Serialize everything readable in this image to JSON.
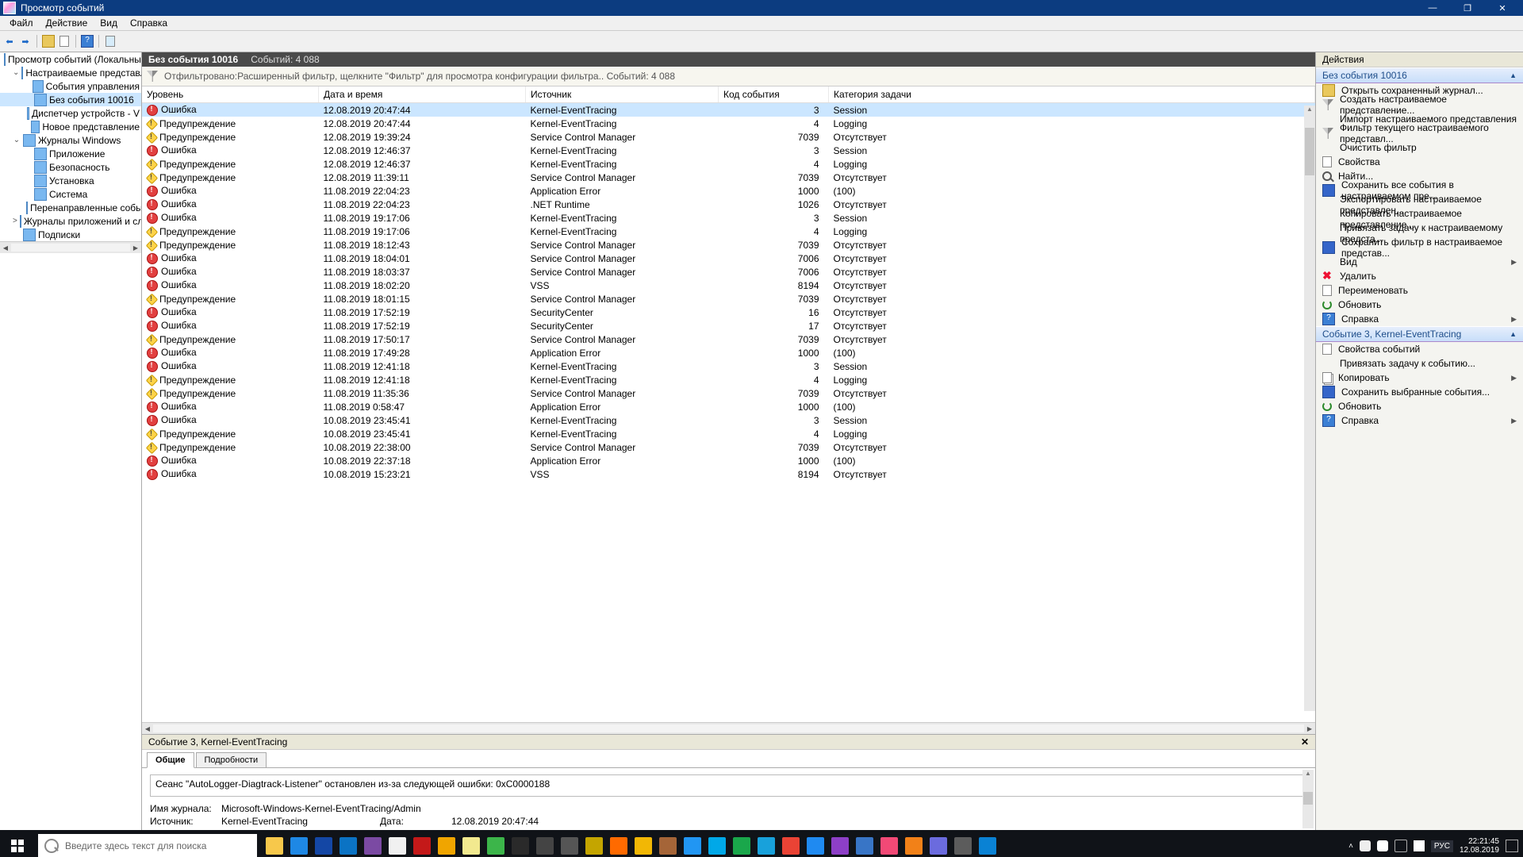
{
  "window": {
    "title": "Просмотр событий",
    "min": "—",
    "max": "❐",
    "close": "✕"
  },
  "menubar": [
    "Файл",
    "Действие",
    "Вид",
    "Справка"
  ],
  "center_header": {
    "title": "Без события 10016",
    "count": "Событий: 4 088"
  },
  "filter_text": "Отфильтровано:Расширенный фильтр, щелкните \"Фильтр\" для просмотра конфигурации фильтра.. Событий: 4 088",
  "tree": [
    {
      "indent": 0,
      "toggle": "",
      "label": "Просмотр событий (Локальный"
    },
    {
      "indent": 1,
      "toggle": "⌄",
      "label": "Настраиваемые представле"
    },
    {
      "indent": 2,
      "toggle": "",
      "label": "События управления"
    },
    {
      "indent": 2,
      "toggle": "",
      "label": "Без события 10016",
      "selected": true
    },
    {
      "indent": 2,
      "toggle": "",
      "label": "Диспетчер устройств - V"
    },
    {
      "indent": 2,
      "toggle": "",
      "label": "Новое представление"
    },
    {
      "indent": 1,
      "toggle": "⌄",
      "label": "Журналы Windows"
    },
    {
      "indent": 2,
      "toggle": "",
      "label": "Приложение"
    },
    {
      "indent": 2,
      "toggle": "",
      "label": "Безопасность"
    },
    {
      "indent": 2,
      "toggle": "",
      "label": "Установка"
    },
    {
      "indent": 2,
      "toggle": "",
      "label": "Система"
    },
    {
      "indent": 2,
      "toggle": "",
      "label": "Перенаправленные собы"
    },
    {
      "indent": 1,
      "toggle": ">",
      "label": "Журналы приложений и слу"
    },
    {
      "indent": 1,
      "toggle": "",
      "label": "Подписки"
    }
  ],
  "columns": {
    "level": "Уровень",
    "datetime": "Дата и время",
    "source": "Источник",
    "code": "Код события",
    "category": "Категория задачи"
  },
  "events": [
    {
      "lv": "e",
      "level": "Ошибка",
      "dt": "12.08.2019 20:47:44",
      "src": "Kernel-EventTracing",
      "code": "3",
      "cat": "Session",
      "sel": true
    },
    {
      "lv": "w",
      "level": "Предупреждение",
      "dt": "12.08.2019 20:47:44",
      "src": "Kernel-EventTracing",
      "code": "4",
      "cat": "Logging"
    },
    {
      "lv": "w",
      "level": "Предупреждение",
      "dt": "12.08.2019 19:39:24",
      "src": "Service Control Manager",
      "code": "7039",
      "cat": "Отсутствует"
    },
    {
      "lv": "e",
      "level": "Ошибка",
      "dt": "12.08.2019 12:46:37",
      "src": "Kernel-EventTracing",
      "code": "3",
      "cat": "Session"
    },
    {
      "lv": "w",
      "level": "Предупреждение",
      "dt": "12.08.2019 12:46:37",
      "src": "Kernel-EventTracing",
      "code": "4",
      "cat": "Logging"
    },
    {
      "lv": "w",
      "level": "Предупреждение",
      "dt": "12.08.2019 11:39:11",
      "src": "Service Control Manager",
      "code": "7039",
      "cat": "Отсутствует"
    },
    {
      "lv": "e",
      "level": "Ошибка",
      "dt": "11.08.2019 22:04:23",
      "src": "Application Error",
      "code": "1000",
      "cat": "(100)"
    },
    {
      "lv": "e",
      "level": "Ошибка",
      "dt": "11.08.2019 22:04:23",
      "src": ".NET Runtime",
      "code": "1026",
      "cat": "Отсутствует"
    },
    {
      "lv": "e",
      "level": "Ошибка",
      "dt": "11.08.2019 19:17:06",
      "src": "Kernel-EventTracing",
      "code": "3",
      "cat": "Session"
    },
    {
      "lv": "w",
      "level": "Предупреждение",
      "dt": "11.08.2019 19:17:06",
      "src": "Kernel-EventTracing",
      "code": "4",
      "cat": "Logging"
    },
    {
      "lv": "w",
      "level": "Предупреждение",
      "dt": "11.08.2019 18:12:43",
      "src": "Service Control Manager",
      "code": "7039",
      "cat": "Отсутствует"
    },
    {
      "lv": "e",
      "level": "Ошибка",
      "dt": "11.08.2019 18:04:01",
      "src": "Service Control Manager",
      "code": "7006",
      "cat": "Отсутствует"
    },
    {
      "lv": "e",
      "level": "Ошибка",
      "dt": "11.08.2019 18:03:37",
      "src": "Service Control Manager",
      "code": "7006",
      "cat": "Отсутствует"
    },
    {
      "lv": "e",
      "level": "Ошибка",
      "dt": "11.08.2019 18:02:20",
      "src": "VSS",
      "code": "8194",
      "cat": "Отсутствует"
    },
    {
      "lv": "w",
      "level": "Предупреждение",
      "dt": "11.08.2019 18:01:15",
      "src": "Service Control Manager",
      "code": "7039",
      "cat": "Отсутствует"
    },
    {
      "lv": "e",
      "level": "Ошибка",
      "dt": "11.08.2019 17:52:19",
      "src": "SecurityCenter",
      "code": "16",
      "cat": "Отсутствует"
    },
    {
      "lv": "e",
      "level": "Ошибка",
      "dt": "11.08.2019 17:52:19",
      "src": "SecurityCenter",
      "code": "17",
      "cat": "Отсутствует"
    },
    {
      "lv": "w",
      "level": "Предупреждение",
      "dt": "11.08.2019 17:50:17",
      "src": "Service Control Manager",
      "code": "7039",
      "cat": "Отсутствует"
    },
    {
      "lv": "e",
      "level": "Ошибка",
      "dt": "11.08.2019 17:49:28",
      "src": "Application Error",
      "code": "1000",
      "cat": "(100)"
    },
    {
      "lv": "e",
      "level": "Ошибка",
      "dt": "11.08.2019 12:41:18",
      "src": "Kernel-EventTracing",
      "code": "3",
      "cat": "Session"
    },
    {
      "lv": "w",
      "level": "Предупреждение",
      "dt": "11.08.2019 12:41:18",
      "src": "Kernel-EventTracing",
      "code": "4",
      "cat": "Logging"
    },
    {
      "lv": "w",
      "level": "Предупреждение",
      "dt": "11.08.2019 11:35:36",
      "src": "Service Control Manager",
      "code": "7039",
      "cat": "Отсутствует"
    },
    {
      "lv": "e",
      "level": "Ошибка",
      "dt": "11.08.2019 0:58:47",
      "src": "Application Error",
      "code": "1000",
      "cat": "(100)"
    },
    {
      "lv": "e",
      "level": "Ошибка",
      "dt": "10.08.2019 23:45:41",
      "src": "Kernel-EventTracing",
      "code": "3",
      "cat": "Session"
    },
    {
      "lv": "w",
      "level": "Предупреждение",
      "dt": "10.08.2019 23:45:41",
      "src": "Kernel-EventTracing",
      "code": "4",
      "cat": "Logging"
    },
    {
      "lv": "w",
      "level": "Предупреждение",
      "dt": "10.08.2019 22:38:00",
      "src": "Service Control Manager",
      "code": "7039",
      "cat": "Отсутствует"
    },
    {
      "lv": "e",
      "level": "Ошибка",
      "dt": "10.08.2019 22:37:18",
      "src": "Application Error",
      "code": "1000",
      "cat": "(100)"
    },
    {
      "lv": "e",
      "level": "Ошибка",
      "dt": "10.08.2019 15:23:21",
      "src": "VSS",
      "code": "8194",
      "cat": "Отсутствует"
    }
  ],
  "detail": {
    "header": "Событие 3, Kernel-EventTracing",
    "tabs": {
      "general": "Общие",
      "details": "Подробности"
    },
    "desc": "Сеанс \"AutoLogger-Diagtrack-Listener\" остановлен из-за следующей ошибки: 0xC0000188",
    "log_name_label": "Имя журнала:",
    "log_name": "Microsoft-Windows-Kernel-EventTracing/Admin",
    "source_label": "Источник:",
    "source": "Kernel-EventTracing",
    "date_label": "Дата:",
    "date": "12.08.2019 20:47:44"
  },
  "actions": {
    "pane_title": "Действия",
    "section1": "Без события 10016",
    "items1": [
      {
        "ic": "open",
        "label": "Открыть сохраненный журнал..."
      },
      {
        "ic": "funnel",
        "label": "Создать настраиваемое представление..."
      },
      {
        "ic": "",
        "label": "Импорт настраиваемого представления"
      },
      {
        "ic": "funnel",
        "label": "Фильтр текущего настраиваемого представл..."
      },
      {
        "ic": "",
        "label": "Очистить фильтр"
      },
      {
        "ic": "prop",
        "label": "Свойства"
      },
      {
        "ic": "find",
        "label": "Найти..."
      },
      {
        "ic": "save",
        "label": "Сохранить все события в настраиваемом пре..."
      },
      {
        "ic": "",
        "label": "Экспортировать настраиваемое представлен..."
      },
      {
        "ic": "",
        "label": "Копировать настраиваемое представление..."
      },
      {
        "ic": "",
        "label": "Привязать задачу к настраиваемому предста..."
      },
      {
        "ic": "save",
        "label": "Сохранить фильтр в настраиваемое представ..."
      },
      {
        "ic": "",
        "label": "Вид",
        "sub": true
      },
      {
        "ic": "delete",
        "mark": "✖",
        "label": "Удалить"
      },
      {
        "ic": "prop",
        "label": "Переименовать"
      },
      {
        "ic": "refresh",
        "label": "Обновить"
      },
      {
        "ic": "help",
        "mark": "?",
        "label": "Справка",
        "sub": true
      }
    ],
    "section2": "Событие 3, Kernel-EventTracing",
    "items2": [
      {
        "ic": "prop",
        "label": "Свойства событий"
      },
      {
        "ic": "",
        "label": "Привязать задачу к событию..."
      },
      {
        "ic": "copy",
        "label": "Копировать",
        "sub": true
      },
      {
        "ic": "save",
        "label": "Сохранить выбранные события..."
      },
      {
        "ic": "refresh",
        "label": "Обновить"
      },
      {
        "ic": "help",
        "mark": "?",
        "label": "Справка",
        "sub": true
      }
    ]
  },
  "taskbar": {
    "search_placeholder": "Введите здесь текст для поиска",
    "icon_colors": [
      "#f7c84b",
      "#1e88e5",
      "#1447a5",
      "#0b73c4",
      "#7b4aa3",
      "#f0f0f0",
      "#c41919",
      "#f0a500",
      "#f2e98f",
      "#3cb54a",
      "#2a2a2a",
      "#444",
      "#555",
      "#c4a500",
      "#ff6a00",
      "#f2b705",
      "#a56538",
      "#2196f3",
      "#00a8e8",
      "#1aa74b",
      "#18a1db",
      "#ea4335",
      "#1f8af1",
      "#8d3fc7",
      "#3875c6",
      "#f24976",
      "#f28118",
      "#6b6bde",
      "#5c5c5c",
      "#0a82d4"
    ],
    "lang": "РУС",
    "time": "22:21:45",
    "date": "12.08.2019"
  }
}
